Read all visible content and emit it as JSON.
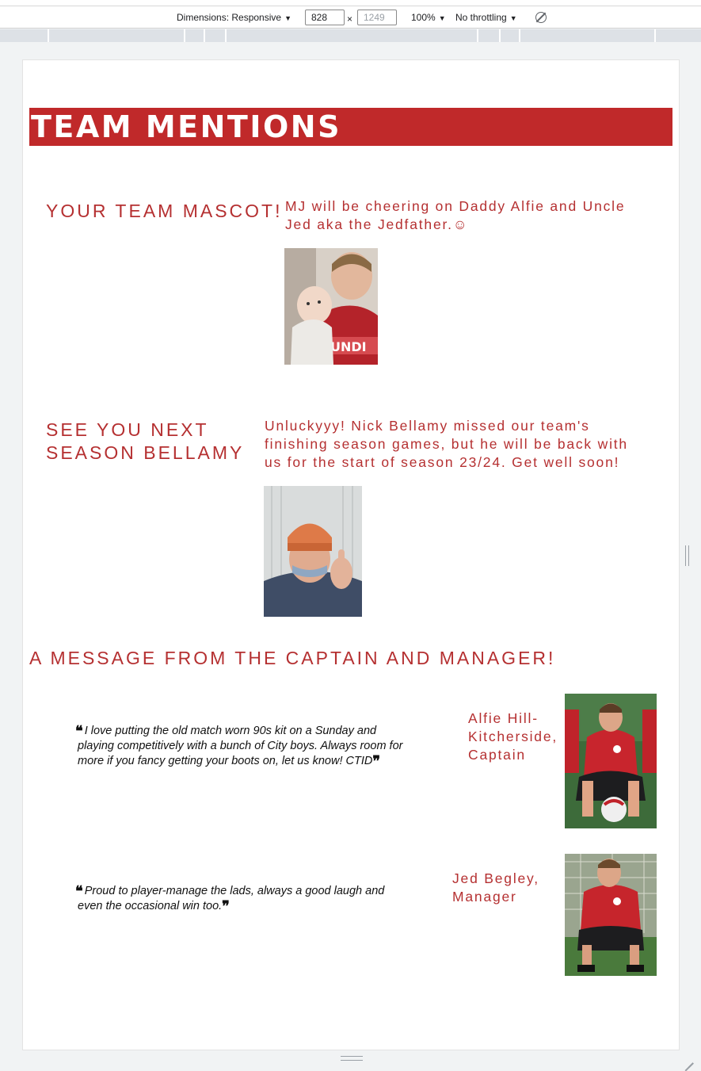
{
  "devtools": {
    "dimensions_label": "Dimensions: Responsive",
    "width_value": "828",
    "times": "×",
    "height_placeholder": "1249",
    "zoom": "100%",
    "throttling": "No throttling",
    "rotate_icon": "rotate-icon"
  },
  "page": {
    "banner_title": "TEAM MENTIONS",
    "sections": [
      {
        "title": "YOUR TEAM MASCOT!",
        "text_line1": "MJ will be cheering on Daddy Alfie and Uncle",
        "text_line2": "Jed aka the Jedfather.☺"
      },
      {
        "title_line1": "SEE YOU NEXT",
        "title_line2": "SEASON BELLAMY",
        "text_line1": "Unluckyyy! Nick Bellamy missed our team's",
        "text_line2": "finishing season games, but he will be back with",
        "text_line3": "us for the start of season 23/24. Get well soon!"
      }
    ],
    "message_heading": "A MESSAGE FROM THE CAPTAIN AND MANAGER!",
    "quotes": [
      {
        "line1": "I love putting the old match worn 90s kit on a Sunday and",
        "line2": "playing competitively with a bunch of City boys. Always room for",
        "line3": "more if you fancy getting your boots on, let us know! CTID",
        "sig_line1": "Alfie Hill-",
        "sig_line2": "Kitcherside,",
        "sig_line3": "Captain"
      },
      {
        "line1": "Proud to player-manage the lads, always a good laugh and",
        "line2": "even the occasional win too.",
        "sig_line1": "Jed Begley,",
        "sig_line2": "Manager"
      }
    ],
    "open_quote": "❝",
    "close_quote": "❞"
  },
  "colors": {
    "brand_red": "#c0292a",
    "text_red": "#b53031"
  }
}
